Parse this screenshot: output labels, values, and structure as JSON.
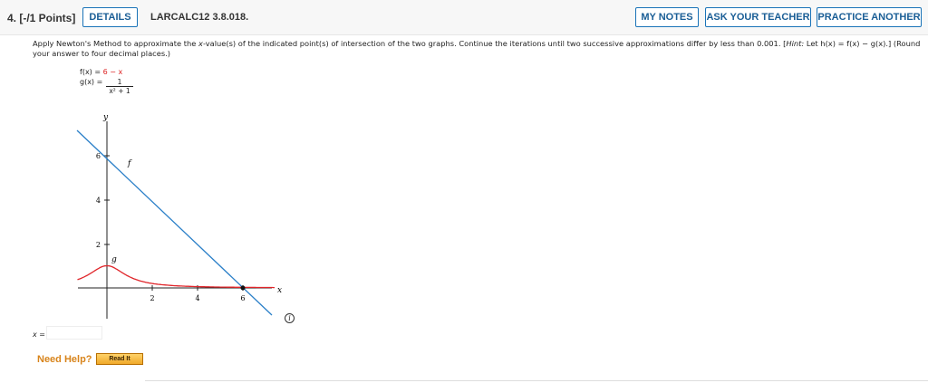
{
  "header": {
    "points": "4. [-/1 Points]",
    "details_label": "DETAILS",
    "code": "LARCALC12 3.8.018.",
    "my_notes_label": "MY NOTES",
    "ask_teacher_label": "ASK YOUR TEACHER",
    "practice_label": "PRACTICE ANOTHER"
  },
  "prompt": {
    "text1": "Apply Newton's Method to approximate the ",
    "xvar": "x",
    "text2": "-value(s) of the indicated point(s) of intersection of the two graphs. Continue the iterations until two successive approximations differ by less than 0.001. [",
    "hint_word": "Hint:",
    "text3": " Let h(x) = f(x) − g(x).] (Round your answer to four decimal places.)"
  },
  "functions": {
    "f_lhs": "f(x) = ",
    "f_rhs": "6 − x",
    "g_lhs": "g(x) = ",
    "g_num": "1",
    "g_den": "x² + 1"
  },
  "graph": {
    "y_label": "y",
    "x_label": "x",
    "f_label": "f",
    "g_label": "g",
    "y_ticks": [
      "6",
      "4",
      "2"
    ],
    "x_ticks": [
      "2",
      "4",
      "6"
    ]
  },
  "answer": {
    "label": "x =",
    "value": ""
  },
  "help": {
    "need_help": "Need Help?",
    "read_it": "Read It"
  },
  "colors": {
    "f_curve": "#2a7fc8",
    "g_curve": "#e0252a",
    "button_border": "#1a73b8",
    "need_help": "#d8841b"
  }
}
